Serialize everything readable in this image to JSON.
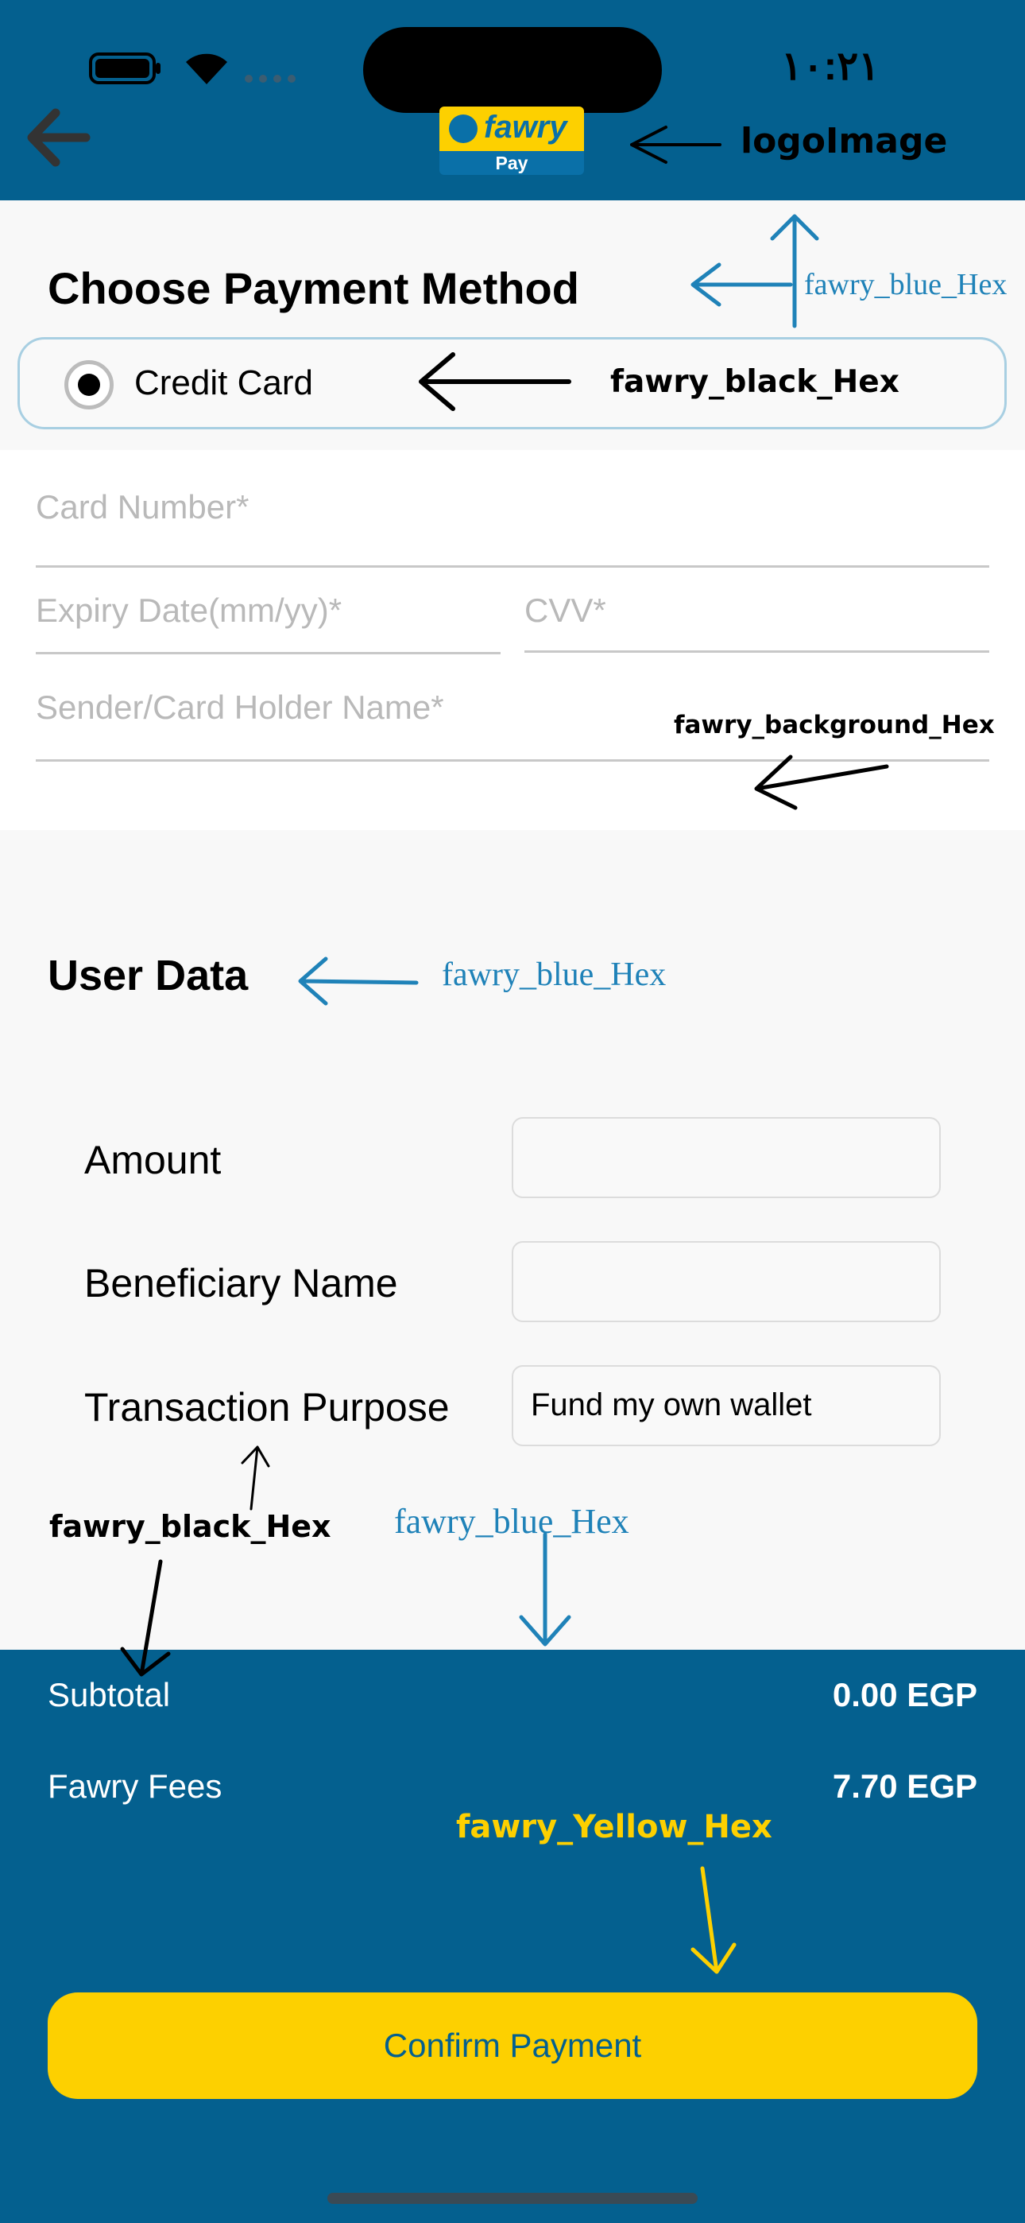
{
  "status_bar": {
    "time": "١٠:٢١"
  },
  "logo": {
    "brand": "fawry",
    "sub": "Pay"
  },
  "payment_method": {
    "title": "Choose Payment Method",
    "option_label": "Credit Card"
  },
  "card_form": {
    "card_number_placeholder": "Card Number*",
    "expiry_placeholder": "Expiry Date(mm/yy)*",
    "cvv_placeholder": "CVV*",
    "holder_placeholder": "Sender/Card Holder Name*"
  },
  "user_data": {
    "title": "User Data",
    "rows": [
      {
        "label": "Amount",
        "value": ""
      },
      {
        "label": "Beneficiary Name",
        "value": ""
      },
      {
        "label": "Transaction Purpose",
        "value": "Fund my own wallet"
      }
    ]
  },
  "summary": {
    "subtotal_label": "Subtotal",
    "subtotal_value": "0.00 EGP",
    "fees_label": "Fawry Fees",
    "fees_value": "7.70 EGP",
    "confirm_label": "Confirm Payment"
  },
  "annotations": {
    "logo": "logoImage",
    "blue_title": "fawry_blue_Hex",
    "black_option": "fawry_black_Hex",
    "background": "fawry_background_Hex",
    "blue_user": "fawry_blue_Hex",
    "black_label": "fawry_black_Hex",
    "blue_footer": "fawry_blue_Hex",
    "yellow_button": "fawry_Yellow_Hex"
  },
  "colors": {
    "fawry_blue": "#04608f",
    "fawry_yellow": "#fdd000",
    "fawry_black": "#000000",
    "fawry_background": "#f8f8f8",
    "annotation_blue": "#1f82b8"
  }
}
